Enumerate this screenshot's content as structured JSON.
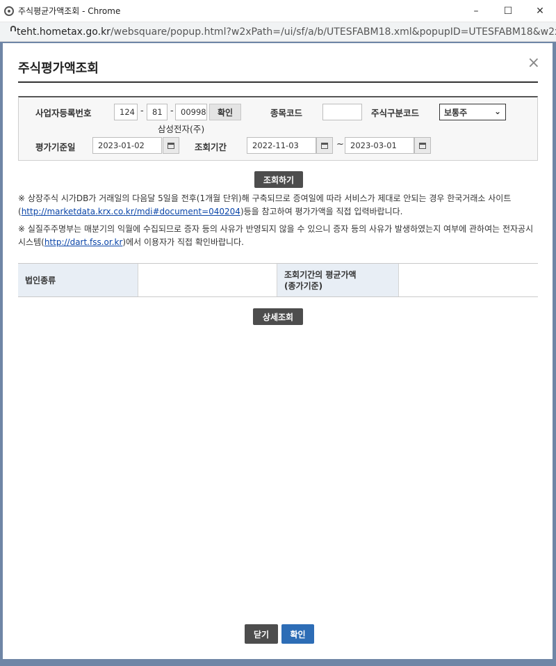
{
  "window": {
    "title": "주식평균가액조회 - Chrome",
    "minimize": "–",
    "maximize": "☐",
    "close": "✕"
  },
  "address": {
    "host": "teht.hometax.go.kr",
    "path": "/websquare/popup.html?w2xPath=/ui/sf/a/b/UTESFABM18.xml&popupID=UTESFABM18&w2xHo..."
  },
  "popup": {
    "title": "주식평가액조회",
    "close": "×"
  },
  "search": {
    "bizno_label": "사업자등록번호",
    "bizno_1": "124",
    "bizno_2": "81",
    "bizno_3": "00998",
    "dash": "-",
    "confirm_label": "확인",
    "company_name": "삼성전자(주)",
    "stock_code_label": "종목코드",
    "stock_code_value": "",
    "stock_type_label": "주식구분코드",
    "stock_type_value": "보통주",
    "eval_date_label": "평가기준일",
    "eval_date": "2023-01-02",
    "period_label": "조회기간",
    "period_from": "2022-11-03",
    "tilde": "~",
    "period_to": "2023-03-01"
  },
  "actions": {
    "search_label": "조회하기",
    "detail_label": "상세조회",
    "close_label": "닫기",
    "ok_label": "확인"
  },
  "notes": {
    "note1_a": "※ 상장주식 시가DB가 거래일의 다음달 5일을 전후(1개월 단위)해 구축되므로 증여일에 따라 서비스가 제대로 안되는 경우 한국거래소 사이트(",
    "note1_link": "http://marketdata.krx.co.kr/mdi#document=040204",
    "note1_b": ")등을 참고하여 평가가액을 직접 입력바랍니다.",
    "note2_a": "※ 실질주주명부는 매분기의 익월에 수집되므로 증자 등의 사유가 반영되지 않을 수 있으니 증자 등의 사유가 발생하였는지 여부에 관하여는 전자공시시스템(",
    "note2_link": "http://dart.fss.or.kr",
    "note2_b": ")에서 이용자가 직접 확인바랍니다."
  },
  "result": {
    "corp_type_label": "법인종류",
    "corp_type_value": "",
    "avg_price_label_1": "조회기간의 평균가액",
    "avg_price_label_2": "(종가기준)",
    "avg_price_value": ""
  }
}
